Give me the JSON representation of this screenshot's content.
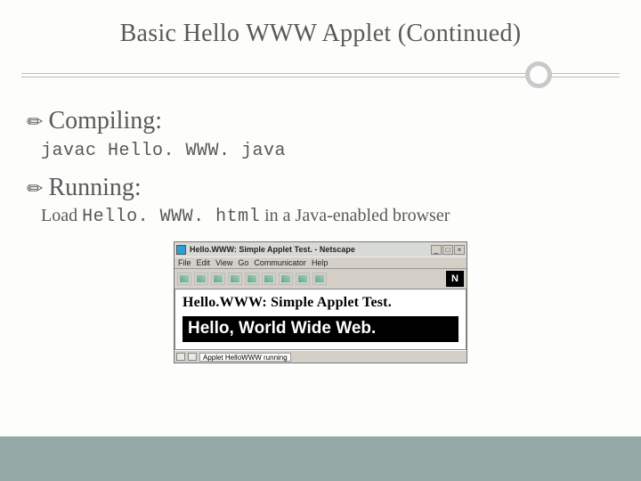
{
  "title": "Basic Hello WWW Applet (Continued)",
  "sections": {
    "compiling": {
      "label": "Compiling:",
      "command": "javac Hello. WWW. java"
    },
    "running": {
      "label": "Running:",
      "prefix": "Load ",
      "file": "Hello. WWW. html",
      "suffix": " in a Java-enabled browser"
    }
  },
  "browser": {
    "title": "Hello.WWW: Simple Applet Test. - Netscape",
    "menus": [
      "File",
      "Edit",
      "View",
      "Go",
      "Communicator",
      "Help"
    ],
    "logo": "N",
    "page_heading": "Hello.WWW: Simple Applet Test.",
    "applet_output": "Hello, World Wide Web.",
    "status_text": "Applet HelloWWW running"
  }
}
